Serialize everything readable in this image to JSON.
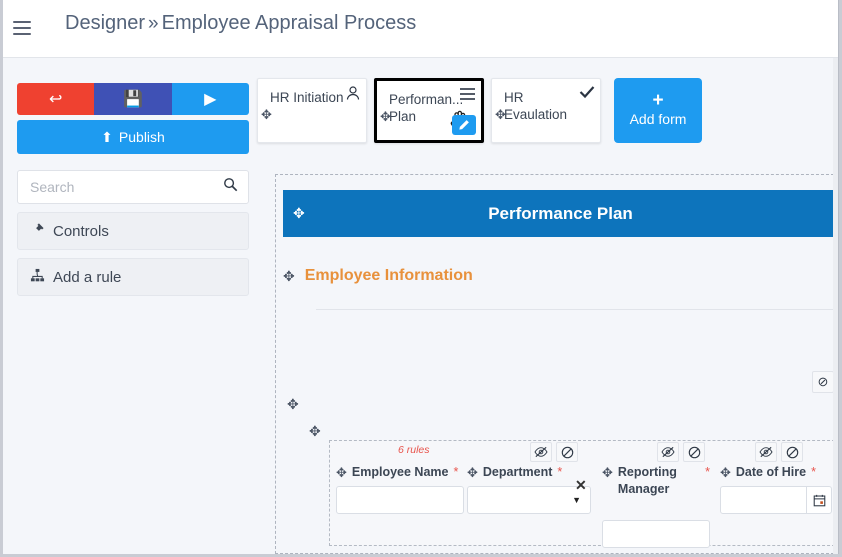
{
  "header": {
    "menu_icon": "hamburger-icon",
    "breadcrumb_root": "Designer",
    "breadcrumb_separator": "»",
    "breadcrumb_current": "Employee Appraisal Process"
  },
  "sidebar": {
    "toolbar": [
      {
        "name": "exit",
        "icon": "sign-out-icon",
        "glyph": "↩",
        "color": "#ef4130"
      },
      {
        "name": "save",
        "icon": "floppy-disk-icon",
        "glyph": "💾",
        "color": "#3f51b5"
      },
      {
        "name": "run",
        "icon": "play-icon",
        "glyph": "▶",
        "color": "#1e9bf0"
      }
    ],
    "publish": {
      "label": "Publish",
      "icon": "upload-icon",
      "glyph": "⬆",
      "color": "#1e9bf0"
    },
    "search": {
      "placeholder": "Search",
      "value": "",
      "icon": "search-icon"
    },
    "items": [
      {
        "label": "Controls",
        "icon": "hammer-icon",
        "glyph": "🔨"
      },
      {
        "label": "Add a rule",
        "icon": "sitemap-icon",
        "glyph": "⛭"
      }
    ]
  },
  "tabs": [
    {
      "label": "HR Initiation",
      "icon": "user-icon",
      "glyph": "👤",
      "selected": false
    },
    {
      "label": "Performan... Plan",
      "icon": "list-icon",
      "glyph": "☰",
      "selected": true,
      "edit_icon": "pencil-icon",
      "edit_glyph": "✎"
    },
    {
      "label": "HR Evaulation",
      "icon": "check-icon",
      "glyph": "✔",
      "selected": false
    }
  ],
  "add_form": {
    "label": "Add form",
    "icon": "plus-icon",
    "glyph": "+"
  },
  "form": {
    "title": "Performance Plan",
    "move_glyph": "✥",
    "section_title": "Employee Information",
    "rules_badge": "6 rules",
    "container_ban_icon": "ban-icon",
    "ban_glyph": "⊘",
    "eye_slash_glyph": "ᐧ",
    "remove_glyph": "✕",
    "fields": [
      {
        "label": "Employee Name",
        "required": "*",
        "type": "text",
        "value": "",
        "toggles": []
      },
      {
        "label": "Department",
        "required": "*",
        "type": "select",
        "value": "",
        "caret": "▼",
        "toggles": [
          "eye-slash-icon",
          "ban-icon"
        ]
      },
      {
        "label": "Reporting Manager",
        "required": "*",
        "type": "text",
        "value": "",
        "toggles": [
          "eye-slash-icon",
          "ban-icon"
        ]
      },
      {
        "label": "Date of Hire",
        "required": "*",
        "type": "date",
        "value": "",
        "calendar_icon": "calendar-icon",
        "calendar_glyph": "📅",
        "toggles": [
          "eye-slash-icon",
          "ban-icon"
        ]
      }
    ]
  },
  "colors": {
    "accent_blue": "#1e9bf0",
    "form_header_blue": "#0d74bc",
    "section_orange": "#e8913c",
    "danger_red": "#ef4130",
    "rules_red": "#e8554d",
    "save_indigo": "#3f51b5",
    "page_bg": "#f4f6fa"
  }
}
